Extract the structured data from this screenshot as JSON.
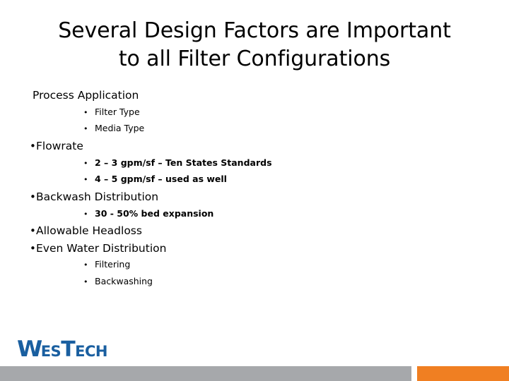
{
  "slide": {
    "title": "Several Design Factors are Important to all Filter Configurations",
    "title_line1": "Several Design Factors are Important",
    "title_line2": "to all Filter Configurations"
  },
  "body": {
    "items": [
      {
        "level": 0,
        "bullet": "",
        "text": "Process Application",
        "bold": false
      },
      {
        "level": 2,
        "bullet": "•",
        "text": "Filter Type",
        "bold": false
      },
      {
        "level": 2,
        "bullet": "•",
        "text": "Media Type",
        "bold": false
      },
      {
        "level": 1,
        "bullet": "•",
        "text": "Flowrate",
        "bold": false
      },
      {
        "level": 2,
        "bullet": "•",
        "text": "2 – 3 gpm/sf – Ten States Standards",
        "bold": true
      },
      {
        "level": 2,
        "bullet": "•",
        "text": "4 – 5 gpm/sf – used as well",
        "bold": true
      },
      {
        "level": 1,
        "bullet": "•",
        "text": "Backwash Distribution",
        "bold": false
      },
      {
        "level": 2,
        "bullet": "•",
        "text": "30 - 50% bed expansion",
        "bold": true
      },
      {
        "level": 1,
        "bullet": "•",
        "text": "Allowable Headloss",
        "bold": false
      },
      {
        "level": 1,
        "bullet": "•",
        "text": "Even Water Distribution",
        "bold": false
      },
      {
        "level": 2,
        "bullet": "•",
        "text": "Filtering",
        "bold": false
      },
      {
        "level": 2,
        "bullet": "•",
        "text": "Backwashing",
        "bold": false
      }
    ]
  },
  "logo": {
    "part1_cap": "W",
    "part1_small": "ES",
    "part2_cap": "T",
    "part2_small": "ECH",
    "full_text": "WesTech",
    "color": "#1A5FA0"
  },
  "footer": {
    "bar_gray_color": "#A6A8AB",
    "bar_orange_color": "#F07F22"
  }
}
